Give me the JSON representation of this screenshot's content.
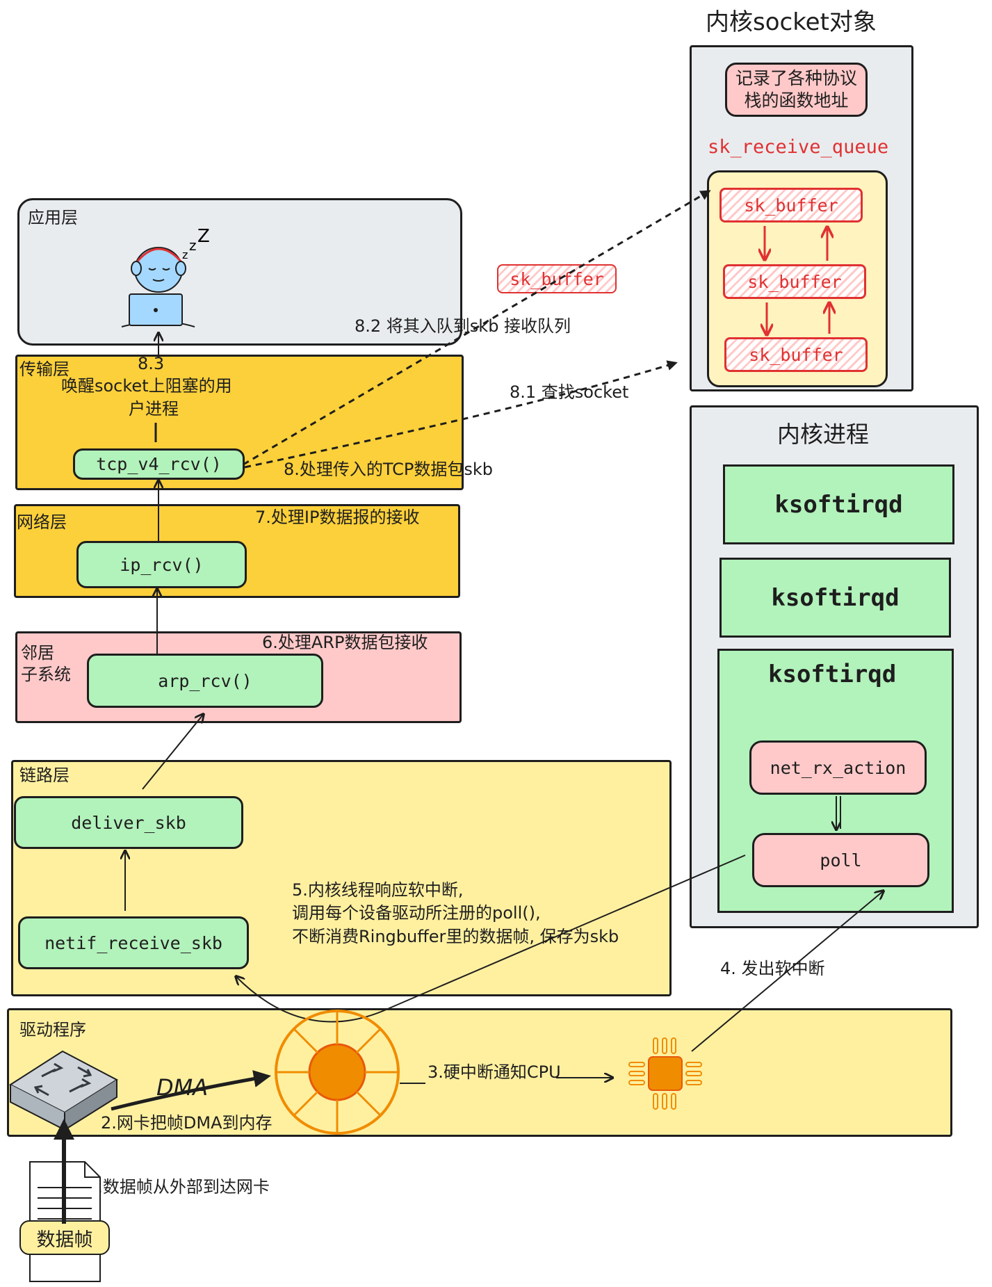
{
  "kernel_socket": {
    "title": "内核socket对象",
    "protocol_note_line1": "记录了各种协议",
    "protocol_note_line2": "栈的函数地址",
    "queue_label": "sk_receive_queue",
    "buffers": [
      "sk_buffer",
      "sk_buffer",
      "sk_buffer"
    ]
  },
  "floating_buffer": "sk_buffer",
  "kernel_process": {
    "title": "内核进程",
    "threads": [
      "ksoftirqd",
      "ksoftirqd",
      "ksoftirqd"
    ],
    "net_rx_action": "net_rx_action",
    "poll": "poll"
  },
  "layers": {
    "app": "应用层",
    "transport": "传输层",
    "network": "网络层",
    "neighbor_line1": "邻居",
    "neighbor_line2": "子系统",
    "link": "链路层",
    "driver": "驱动程序"
  },
  "functions": {
    "tcp": "tcp_v4_rcv()",
    "ip": "ip_rcv()",
    "arp": "arp_rcv()",
    "deliver": "deliver_skb",
    "netif": "netif_receive_skb"
  },
  "steps": {
    "s1": "1.数据帧从外部到达网卡",
    "s2": "2.网卡把帧DMA到内存",
    "dma": "DMA",
    "s3": "3.硬中断通知CPU",
    "s4": "4. 发出软中断",
    "s5_line1": "5.内核线程响应软中断,",
    "s5_line2": "调用每个设备驱动所注册的poll(),",
    "s5_line3": "不断消费Ringbuffer里的数据帧, 保存为skb",
    "s6": "6.处理ARP数据包接收",
    "s7": "7.处理IP数据报的接收",
    "s8": "8.处理传入的TCP数据包skb",
    "s81": "8.1 查找socket",
    "s82": "8.2 将其入队到skb 接收队列",
    "s83": "8.3",
    "s83_line1": "唤醒socket上阻塞的用",
    "s83_line2": "户进程"
  },
  "data_frame": "数据帧",
  "colors": {
    "yellow": "#fcd03a",
    "light_yellow": "#fff0a0",
    "pink": "#ffc9c9",
    "green": "#b2f2bb",
    "gray": "#e9ecef",
    "red": "#e03131",
    "orange": "#f08c00"
  }
}
